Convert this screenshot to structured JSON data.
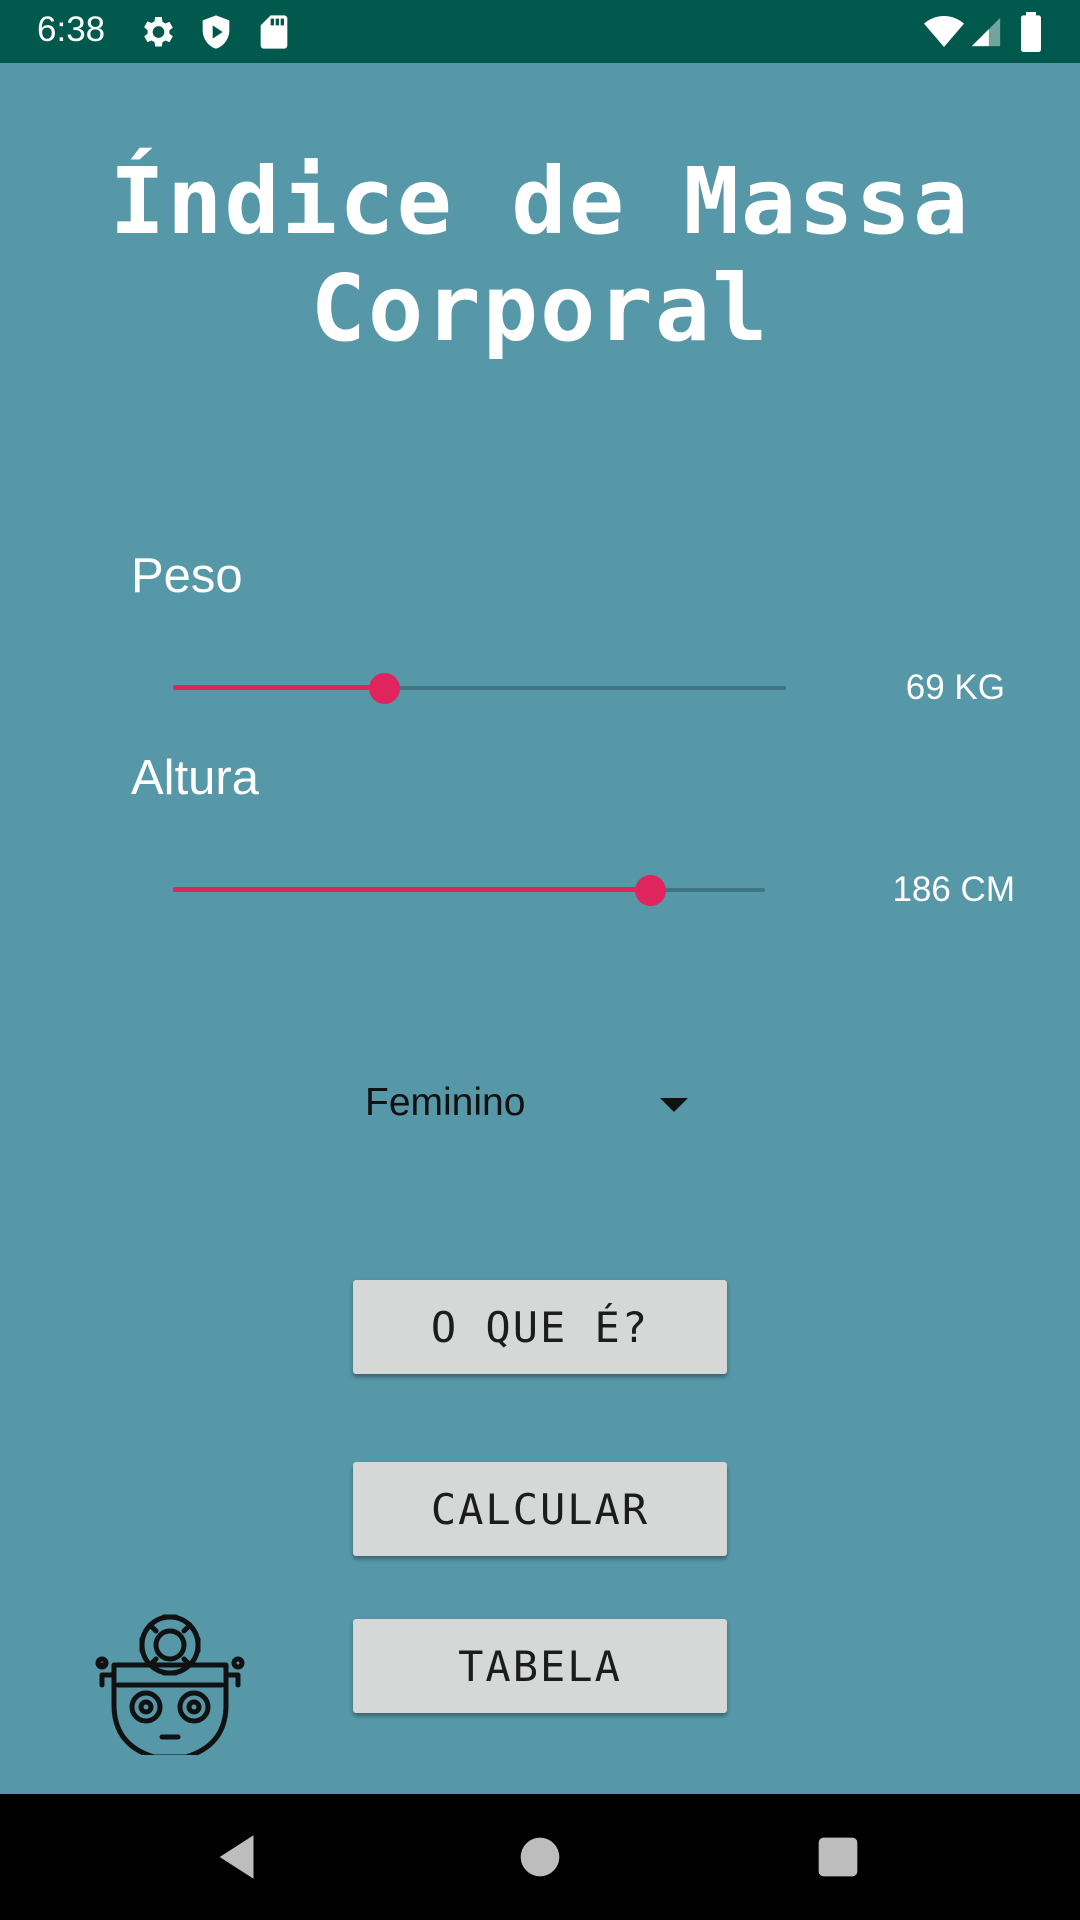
{
  "status_bar": {
    "time": "6:38",
    "left_icons": [
      "settings-gear-icon",
      "shield-icon",
      "sd-card-icon"
    ],
    "right_icons": [
      "wifi-icon",
      "cell-signal-icon",
      "battery-icon"
    ],
    "background": "#00594c"
  },
  "app": {
    "title": "Índice de Massa Corporal",
    "background": "#5698a8",
    "accent": "#e0255e"
  },
  "weight": {
    "label": "Peso",
    "value_text": "69 KG",
    "slider_fraction": 0.345
  },
  "height": {
    "label": "Altura",
    "value_text": "186 CM",
    "slider_fraction": 0.805
  },
  "gender": {
    "selected": "Feminino"
  },
  "buttons": {
    "what_is": "O QUE É?",
    "calculate": "CALCULAR",
    "table": "TABELA"
  },
  "logo": {
    "icon": "robot-icon"
  },
  "nav_bar": {
    "icons": [
      "back-icon",
      "home-icon",
      "recents-icon"
    ]
  }
}
